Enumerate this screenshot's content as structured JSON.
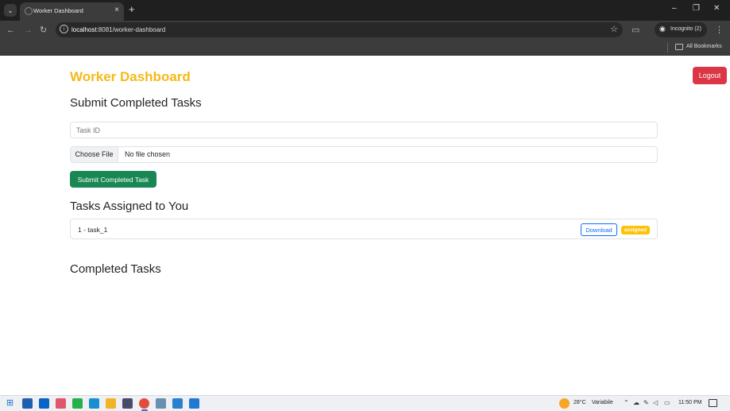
{
  "browser": {
    "tab_title": "Worker Dashboard",
    "tab_close": "×",
    "new_tab": "+",
    "url_host": "localhost",
    "url_rest": ":8081/worker-dashboard",
    "incognito_label": "Incognito (2)",
    "bookmarks_label": "All Bookmarks",
    "window_controls": [
      "–",
      "❐",
      "✕"
    ]
  },
  "page": {
    "app_title": "Worker Dashboard",
    "logout_label": "Logout",
    "submit_section_title": "Submit Completed Tasks",
    "task_id_placeholder": "Task ID",
    "file_button_label": "Choose File",
    "file_status": "No file chosen",
    "submit_button_label": "Submit Completed Task",
    "assigned_section_title": "Tasks Assigned to You",
    "assigned_tasks": [
      {
        "label": "1 - task_1",
        "download_label": "Download",
        "status": "assigned"
      }
    ],
    "completed_section_title": "Completed Tasks"
  },
  "colors": {
    "title": "#f5b918",
    "logout": "#dc3545",
    "submit": "#198754",
    "download": "#0d6efd",
    "badge": "#ffc107"
  },
  "taskbar": {
    "weather": "28°C",
    "weather_desc": "Variabile",
    "time": "11:50 PM"
  }
}
